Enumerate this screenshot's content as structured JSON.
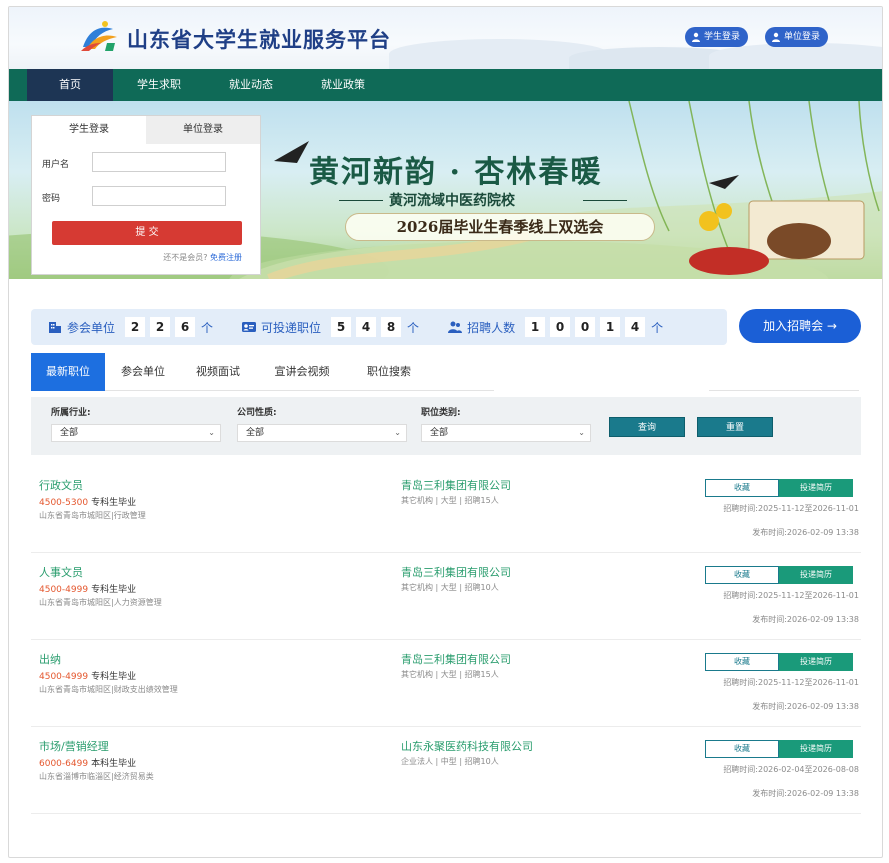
{
  "header": {
    "site_title": "山东省大学生就业服务平台",
    "student_login": "学生登录",
    "employer_login": "单位登录"
  },
  "nav": {
    "items": [
      {
        "label": "首页"
      },
      {
        "label": "学生求职"
      },
      {
        "label": "就业动态"
      },
      {
        "label": "就业政策"
      }
    ]
  },
  "banner": {
    "title": "黄河新韵 · 杏林春暖",
    "subtitle": "黄河流域中医药院校",
    "event": "2026届毕业生春季线上双选会"
  },
  "login": {
    "tab_student": "学生登录",
    "tab_employer": "单位登录",
    "username_label": "用户名",
    "password_label": "密码",
    "submit": "提 交",
    "not_member": "还不是会员?",
    "register": "免费注册"
  },
  "stats": {
    "units_label": "参会单位",
    "units_digits": [
      "2",
      "2",
      "6"
    ],
    "positions_label": "可投递职位",
    "positions_digits": [
      "5",
      "4",
      "8"
    ],
    "hires_label": "招聘人数",
    "hires_digits": [
      "1",
      "0",
      "0",
      "1",
      "4"
    ],
    "unit": "个"
  },
  "join_button": "加入招聘会 →",
  "tabs": [
    {
      "label": "最新职位"
    },
    {
      "label": "参会单位"
    },
    {
      "label": "视频面试"
    },
    {
      "label": "宣讲会视频"
    },
    {
      "label": "职位搜索"
    }
  ],
  "filter": {
    "industry_label": "所属行业:",
    "industry_value": "全部",
    "nature_label": "公司性质:",
    "nature_value": "全部",
    "category_label": "职位类别:",
    "category_value": "全部",
    "query_button": "查询",
    "reset_button": "重置"
  },
  "jobs": [
    {
      "title": "行政文员",
      "salary": "4500-5300",
      "education": "专科生毕业",
      "location": "山东省青岛市城阳区|行政管理",
      "company": "青岛三利集团有限公司",
      "meta": "其它机构 | 大型 | 招聘15人",
      "fav": "收藏",
      "apply": "投递简历",
      "period": "招聘时间:2025-11-12至2026-11-01",
      "published": "发布时间:2026-02-09 13:38"
    },
    {
      "title": "人事文员",
      "salary": "4500-4999",
      "education": "专科生毕业",
      "location": "山东省青岛市城阳区|人力资源管理",
      "company": "青岛三利集团有限公司",
      "meta": "其它机构 | 大型 | 招聘10人",
      "fav": "收藏",
      "apply": "投递简历",
      "period": "招聘时间:2025-11-12至2026-11-01",
      "published": "发布时间:2026-02-09 13:38"
    },
    {
      "title": "出纳",
      "salary": "4500-4999",
      "education": "专科生毕业",
      "location": "山东省青岛市城阳区|财政支出绩效管理",
      "company": "青岛三利集团有限公司",
      "meta": "其它机构 | 大型 | 招聘15人",
      "fav": "收藏",
      "apply": "投递简历",
      "period": "招聘时间:2025-11-12至2026-11-01",
      "published": "发布时间:2026-02-09 13:38"
    },
    {
      "title": "市场/营销经理",
      "salary": "6000-6499",
      "education": "本科生毕业",
      "location": "山东省淄博市临淄区|经济贸易类",
      "company": "山东永聚医药科技有限公司",
      "meta": "企业法人 | 中型 | 招聘10人",
      "fav": "收藏",
      "apply": "投递简历",
      "period": "招聘时间:2026-02-04至2026-08-08",
      "published": "发布时间:2026-02-09 13:38"
    }
  ],
  "colors": {
    "nav_bg": "#0f6a57",
    "nav_active": "#1d3554",
    "accent_blue": "#1d6fe0",
    "accent_green": "#2a9d6e",
    "salary_red": "#e4572e",
    "submit_red": "#d63a33"
  }
}
